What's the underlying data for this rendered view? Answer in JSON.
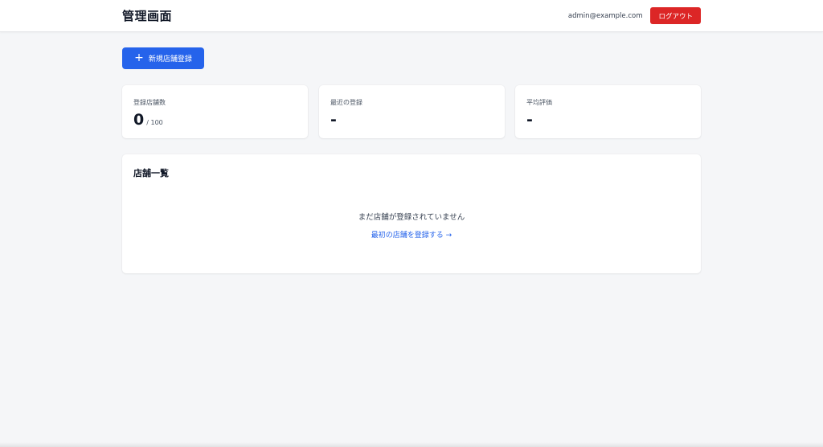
{
  "header": {
    "title": "管理画面",
    "user_email": "admin@example.com",
    "logout_label": "ログアウト"
  },
  "actions": {
    "new_store_label": "新規店舗登録",
    "new_store_icon": "plus-icon"
  },
  "stats": [
    {
      "label": "登録店舗数",
      "value": "0",
      "sub": "/ 100"
    },
    {
      "label": "最近の登録",
      "value": "-",
      "sub": ""
    },
    {
      "label": "平均評価",
      "value": "-",
      "sub": ""
    }
  ],
  "store_list": {
    "title": "店舗一覧",
    "empty_message": "まだ店舗が登録されていません",
    "first_link_label": "最初の店舗を登録する →"
  },
  "colors": {
    "primary": "#2563eb",
    "danger": "#dc2626",
    "background": "#f5f6f8"
  }
}
